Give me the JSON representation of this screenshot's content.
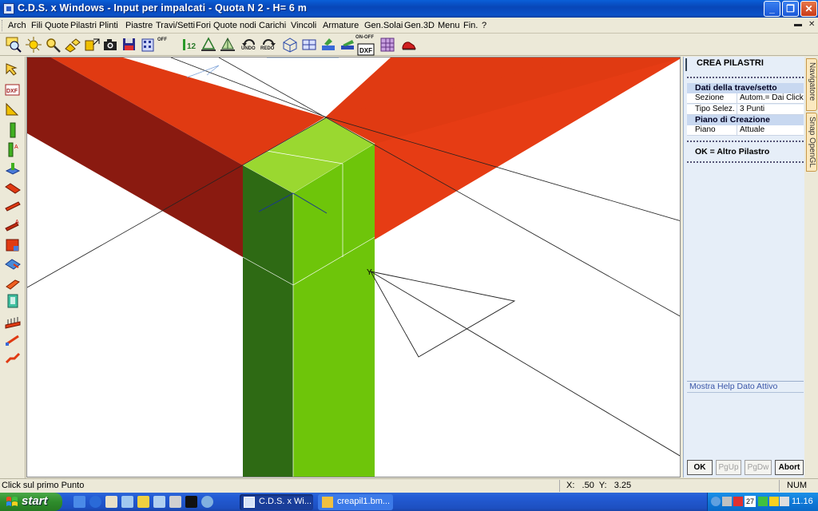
{
  "window": {
    "title": "C.D.S. x Windows - Input per impalcati - Quota N 2 - H= 6 m",
    "colors": {
      "titlebar": "#0a52c8",
      "beam_red": "#e03a12",
      "beam_dark": "#8a1a10",
      "column_light": "#6ec50a",
      "column_dark": "#2e6a14",
      "column_top": "#9ad830"
    }
  },
  "menu": {
    "items": [
      "Arch",
      "Fili",
      "Quote",
      "Pilastri",
      "Plinti",
      "Piastre",
      "Travi/Setti",
      "Fori",
      "Quote nodi",
      "Carichi",
      "Vincoli",
      "Armature",
      "Gen.Solai",
      "Gen.3D",
      "Menu",
      "Fin.",
      "?"
    ]
  },
  "toolbar": {
    "undo_label": "UNDO",
    "redo_label": "REDO",
    "off_label": "OFF",
    "onoff_label": "ON-OFF",
    "icons": [
      "zoom-window-icon",
      "zoom-all-icon",
      "zoom-icon",
      "grid-icon",
      "pan-icon",
      "camera-icon",
      "save-bmp-icon",
      "building-icon",
      "numbering-icon",
      "structure-icon",
      "mesh-icon",
      "undo-icon",
      "redo-icon",
      "view-3d-icon",
      "frame-icon",
      "paint-icon",
      "solid-icon",
      "dxf-icon",
      "color-grid-icon",
      "shoe-icon"
    ]
  },
  "left_tools": {
    "icons": [
      "select-arrow-icon",
      "dxf-import-icon",
      "measure-icon",
      "column-icon",
      "column-edit-icon",
      "base-plate-icon",
      "beam-icon",
      "beam-edit-icon",
      "beam-alt-icon",
      "frame-icon",
      "wall-icon",
      "slab-icon",
      "panel-icon",
      "foundation-icon",
      "stair-icon",
      "ramp-icon"
    ]
  },
  "panel": {
    "title": "CREA PILASTRI",
    "section1": "Dati della trave/setto",
    "rows1": [
      {
        "key": "Sezione",
        "value": "Autom.= Dai Click"
      },
      {
        "key": "Tipo Selez.",
        "value": "3 Punti"
      }
    ],
    "section2": "Piano di Creazione",
    "rows2": [
      {
        "key": "Piano",
        "value": "Attuale"
      }
    ],
    "ok_hint": "OK = Altro Pilastro",
    "help_label": "Mostra Help Dato Attivo",
    "buttons": {
      "ok": "OK",
      "pgup": "PgUp",
      "pgdw": "PgDw",
      "abort": "Abort"
    }
  },
  "side_tabs": [
    "Navigatore",
    "Snap OpenGL"
  ],
  "status": {
    "message": "Click sul primo Punto",
    "coords": "X:   .50  Y:   3.25",
    "num": "NUM"
  },
  "taskbar": {
    "start": "start",
    "tasks": [
      "C.D.S. x Wi...",
      "creapil1.bm..."
    ],
    "tray_date": "27",
    "clock": "11.16"
  }
}
